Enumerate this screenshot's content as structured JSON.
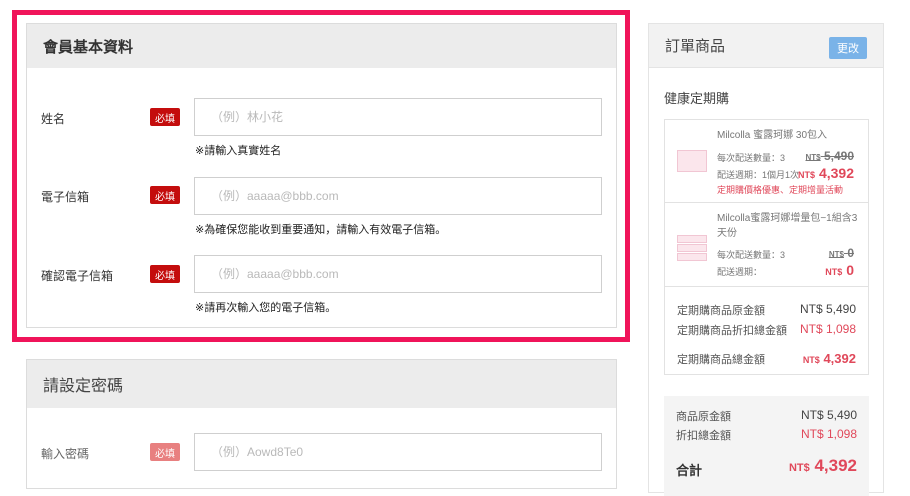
{
  "member_section": {
    "title": "會員基本資料",
    "fields": [
      {
        "label": "姓名",
        "required": "必填",
        "placeholder": "（例）林小花",
        "hint": "※請輸入真實姓名"
      },
      {
        "label": "電子信箱",
        "required": "必填",
        "placeholder": "（例）aaaaa@bbb.com",
        "hint": "※為確保您能收到重要通知，請輸入有效電子信箱。"
      },
      {
        "label": "確認電子信箱",
        "required": "必填",
        "placeholder": "（例）aaaaa@bbb.com",
        "hint": "※請再次輸入您的電子信箱。"
      }
    ]
  },
  "password_section": {
    "title": "請設定密碼",
    "fields": [
      {
        "label": "輸入密碼",
        "required": "必填",
        "placeholder": "（例）Aowd8Te0"
      }
    ]
  },
  "order": {
    "title": "訂單商品",
    "change_label": "更改",
    "subscription_title": "健康定期購",
    "items": [
      {
        "name": "Milcolla 蜜露珂娜 30包入",
        "qty_label": "每次配送數量：3",
        "cycle_label": "配送週期：1個月1次",
        "currency": "NT$",
        "original": "5,490",
        "price": "4,392",
        "promo": "定期購價格優惠、定期增量活動"
      },
      {
        "name": "Milcolla蜜露珂娜增量包−1組含3天份",
        "qty_label": "每次配送數量：3",
        "cycle_label": "配送週期：",
        "currency": "NT$",
        "original": "0",
        "price": "0"
      }
    ],
    "subscription_summary": {
      "original_label": "定期購商品原金額",
      "original_value": "NT$ 5,490",
      "discount_label": "定期購商品折扣總金額",
      "discount_value": "NT$ 1,098",
      "total_label": "定期購商品總金額",
      "total_currency": "NT$",
      "total_value": "4,392"
    },
    "totals": {
      "original_label": "商品原金額",
      "original_value": "NT$ 5,490",
      "discount_label": "折扣總金額",
      "discount_value": "NT$ 1,098",
      "grand_label": "合計",
      "grand_currency": "NT$",
      "grand_value": "4,392"
    }
  },
  "colors": {
    "highlight_border": "#f0145a",
    "required_badge": "#c40d0d",
    "price_red": "#e0485a",
    "change_button": "#7ab3e8"
  }
}
